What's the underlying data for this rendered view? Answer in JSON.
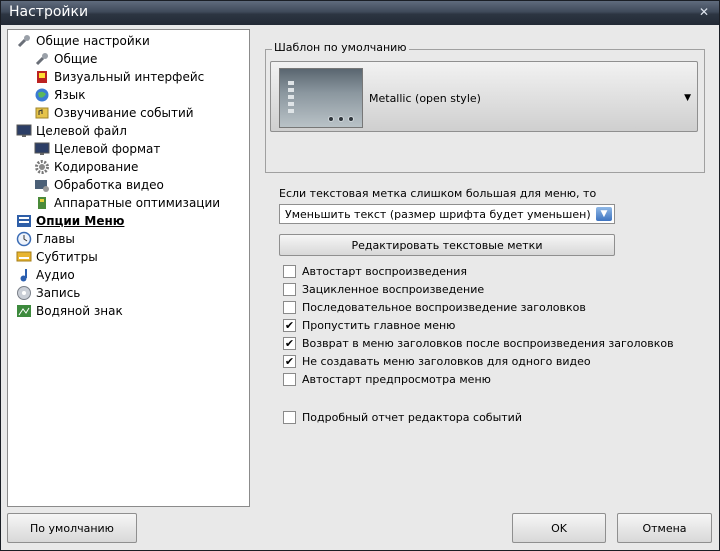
{
  "window": {
    "title": "Настройки",
    "close_glyph": "✕"
  },
  "tree": [
    {
      "label": "Общие настройки",
      "icon": "tools-icon",
      "level": 0,
      "bold": false
    },
    {
      "label": "Общие",
      "icon": "tools-icon",
      "level": 1,
      "bold": false
    },
    {
      "label": "Визуальный интерфейс",
      "icon": "paint-icon",
      "level": 1,
      "bold": false
    },
    {
      "label": "Язык",
      "icon": "globe-icon",
      "level": 1,
      "bold": false
    },
    {
      "label": "Озвучивание событий",
      "icon": "sound-event-icon",
      "level": 1,
      "bold": false
    },
    {
      "label": "Целевой файл",
      "icon": "monitor-icon",
      "level": 0,
      "bold": false
    },
    {
      "label": "Целевой формат",
      "icon": "monitor-icon",
      "level": 1,
      "bold": false
    },
    {
      "label": "Кодирование",
      "icon": "gear-icon",
      "level": 1,
      "bold": false
    },
    {
      "label": "Обработка видео",
      "icon": "video-processing-icon",
      "level": 1,
      "bold": false
    },
    {
      "label": "Аппаратные оптимизации",
      "icon": "hardware-icon",
      "level": 1,
      "bold": false
    },
    {
      "label": "Опции Меню",
      "icon": "menu-list-icon",
      "level": 0,
      "bold": true
    },
    {
      "label": "Главы",
      "icon": "clock-icon",
      "level": 0,
      "bold": false
    },
    {
      "label": "Субтитры",
      "icon": "subtitles-icon",
      "level": 0,
      "bold": false
    },
    {
      "label": "Аудио",
      "icon": "music-note-icon",
      "level": 0,
      "bold": false
    },
    {
      "label": "Запись",
      "icon": "disc-icon",
      "level": 0,
      "bold": false
    },
    {
      "label": "Водяной знак",
      "icon": "watermark-icon",
      "level": 0,
      "bold": false
    }
  ],
  "template": {
    "group_label": "Шаблон по умолчанию",
    "name": "Metallic (open style)",
    "arrow": "▼"
  },
  "label_hint": "Если текстовая метка слишком большая для меню, то",
  "label_select": {
    "value": "Уменьшить текст (размер шрифта будет уменьшен)",
    "arrow": "▼"
  },
  "edit_labels_button": "Редактировать текстовые метки",
  "checkboxes": [
    {
      "label": "Автостарт воспроизведения",
      "checked": false
    },
    {
      "label": "Зацикленное воспроизведение",
      "checked": false
    },
    {
      "label": "Последовательное воспроизведение заголовков",
      "checked": false
    },
    {
      "label": "Пропустить главное меню",
      "checked": true
    },
    {
      "label": "Возврат в меню заголовков после воспроизведения заголовков",
      "checked": true
    },
    {
      "label": "Не создавать меню заголовков для одного видео",
      "checked": true
    },
    {
      "label": "Автостарт предпросмотра меню",
      "checked": false
    }
  ],
  "event_log_checkbox": {
    "label": "Подробный отчет редактора событий",
    "checked": false
  },
  "buttons": {
    "defaults": "По умолчанию",
    "ok": "OK",
    "cancel": "Отмена"
  },
  "check_glyph": "✔"
}
